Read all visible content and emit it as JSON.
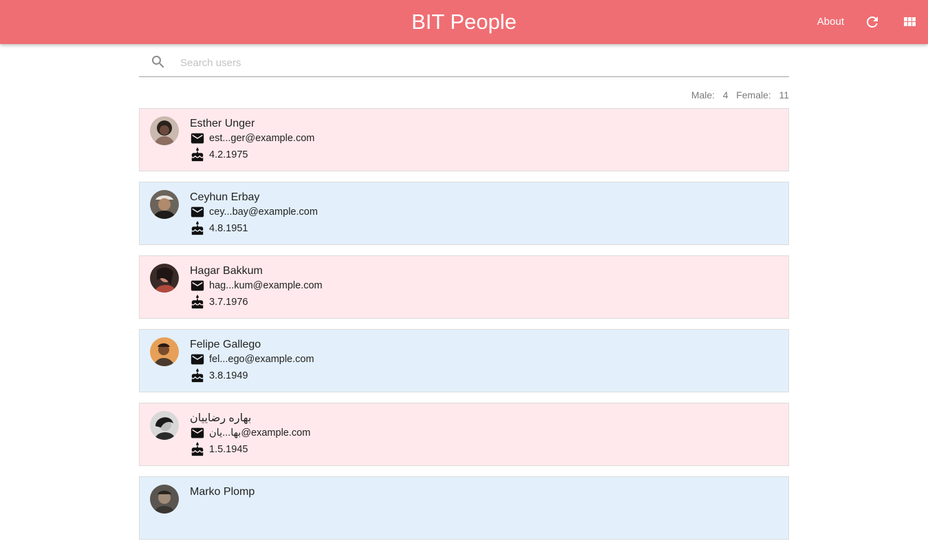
{
  "app": {
    "title": "BIT People",
    "about_label": "About",
    "accent_color": "#ef6e73",
    "icons": [
      "refresh-icon",
      "grid-view-icon",
      "search-icon",
      "email-icon",
      "cake-icon"
    ]
  },
  "search": {
    "placeholder": "Search users",
    "value": ""
  },
  "stats": {
    "male_label": "Male:",
    "male_count": "4",
    "female_label": "Female:",
    "female_count": "11"
  },
  "users": [
    {
      "name": "Esther Unger",
      "email": "est...ger@example.com",
      "dob": "4.2.1975",
      "gender": "female",
      "avatar_color": "#7a5a4e"
    },
    {
      "name": "Ceyhun Erbay",
      "email": "cey...bay@example.com",
      "dob": "4.8.1951",
      "gender": "male",
      "avatar_color": "#8a7a6a"
    },
    {
      "name": "Hagar Bakkum",
      "email": "hag...kum@example.com",
      "dob": "3.7.1976",
      "gender": "female",
      "avatar_color": "#6a3a36"
    },
    {
      "name": "Felipe Gallego",
      "email": "fel...ego@example.com",
      "dob": "3.8.1949",
      "gender": "male",
      "avatar_color": "#e7a058"
    },
    {
      "name": "بهاره رضاییان",
      "email": "بها...یان@example.com",
      "dob": "1.5.1945",
      "gender": "female",
      "avatar_color": "#9a9a9a"
    },
    {
      "name": "Marko Plomp",
      "email": "",
      "dob": "",
      "gender": "male",
      "avatar_color": "#5a5550"
    }
  ],
  "colors": {
    "female_card": "#ffe9ec",
    "male_card": "#e3f0fb"
  }
}
